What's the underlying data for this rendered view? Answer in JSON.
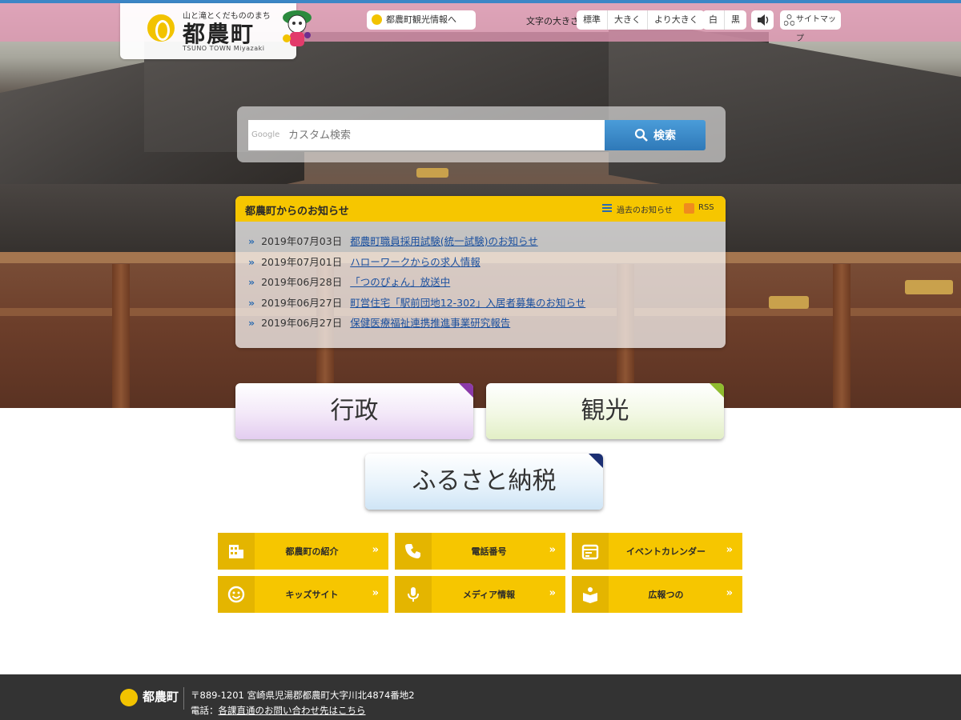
{
  "header": {
    "logo_tagline": "山と滝とくだもののまち",
    "logo_name": "都農町",
    "logo_en": "TSUNO TOWN Miyazaki",
    "tourism_link": "都農町観光情報へ",
    "font_size_label": "文字の大きさ",
    "font_sizes": [
      "標準",
      "大きく",
      "より大きく"
    ],
    "color_modes": [
      "白",
      "黒"
    ],
    "sitemap": "サイトマップ"
  },
  "search": {
    "provider": "Google",
    "placeholder": "カスタム検索",
    "button": "検索"
  },
  "news": {
    "title": "都農町からのお知らせ",
    "past_link": "過去のお知らせ",
    "rss": "RSS",
    "items": [
      {
        "date": "2019年07月03日",
        "title": "都農町職員採用試験(統一試験)のお知らせ"
      },
      {
        "date": "2019年07月01日",
        "title": "ハローワークからの求人情報"
      },
      {
        "date": "2019年06月28日",
        "title": "「つのぴょん」放送中"
      },
      {
        "date": "2019年06月27日",
        "title": "町営住宅「駅前団地12-302」入居者募集のお知らせ"
      },
      {
        "date": "2019年06月27日",
        "title": "保健医療福祉連携推進事業研究報告"
      }
    ]
  },
  "categories": {
    "gyosei": {
      "label": "行政",
      "accent": "#8b3aa8"
    },
    "kanko": {
      "label": "観光",
      "accent": "#8fbc2f"
    },
    "furusato": {
      "label": "ふるさと納税",
      "accent": "#1b2f73"
    }
  },
  "quick_links": [
    {
      "label": "都農町の紹介",
      "icon": "building-icon"
    },
    {
      "label": "電話番号",
      "icon": "phone-icon"
    },
    {
      "label": "イベントカレンダー",
      "icon": "calendar-icon"
    },
    {
      "label": "キッズサイト",
      "icon": "smiley-icon"
    },
    {
      "label": "メディア情報",
      "icon": "microphone-icon"
    },
    {
      "label": "広報つの",
      "icon": "book-icon"
    }
  ],
  "footer": {
    "name": "都農町",
    "address": "〒889-1201 宮崎県児湯郡都農町大字川北4874番地2",
    "tel_prefix": "電話：",
    "tel_link": "各課直通のお問い合わせ先はこちら"
  },
  "colors": {
    "accent_yellow": "#f6c600",
    "topbar_pink": "#e096b2",
    "link_blue": "#1a4f9e",
    "footer_bg": "#333333"
  }
}
